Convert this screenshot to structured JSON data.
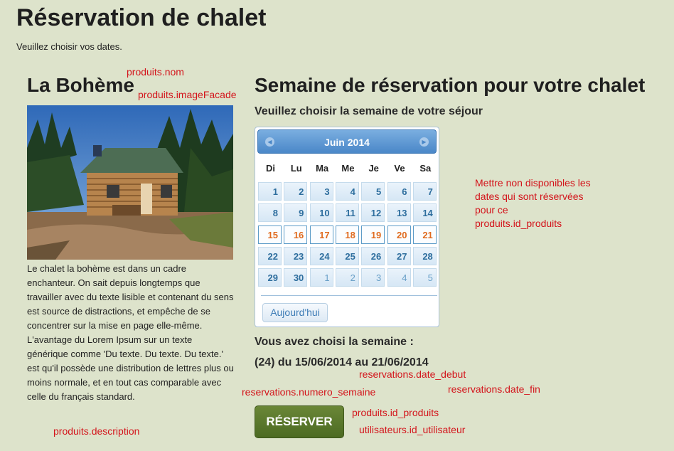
{
  "page": {
    "title": "Réservation de chalet",
    "subtitle": "Veuillez choisir vos dates."
  },
  "chalet": {
    "name": "La Bohème",
    "description": "Le chalet la bohème est dans un cadre enchanteur. On sait depuis longtemps que travailler avec du texte lisible et contenant du sens est source de distractions, et empêche de se concentrer sur la mise en page elle-même. L'avantage du Lorem Ipsum sur un texte générique comme 'Du texte. Du texte. Du texte.' est qu'il possède une distribution de lettres plus ou moins normale, et en tout cas comparable avec celle du français standard."
  },
  "booking": {
    "title": "Semaine de réservation pour votre chalet",
    "subtitle": "Veuillez choisir la semaine de votre séjour",
    "chosen_label": "Vous avez choisi la semaine :",
    "chosen_value": "(24) du 15/06/2014 au 21/06/2014",
    "reserve_label": "RÉSERVER"
  },
  "datepicker": {
    "month": "Juin 2014",
    "weekdays": [
      "Di",
      "Lu",
      "Ma",
      "Me",
      "Je",
      "Ve",
      "Sa"
    ],
    "weeks": [
      [
        "1",
        "2",
        "3",
        "4",
        "5",
        "6",
        "7"
      ],
      [
        "8",
        "9",
        "10",
        "11",
        "12",
        "13",
        "14"
      ],
      [
        "15",
        "16",
        "17",
        "18",
        "19",
        "20",
        "21"
      ],
      [
        "22",
        "23",
        "24",
        "25",
        "26",
        "27",
        "28"
      ],
      [
        "29",
        "30",
        "1",
        "2",
        "3",
        "4",
        "5"
      ]
    ],
    "selected_week_index": 2,
    "next_month_start": {
      "week": 4,
      "day": 2
    },
    "today_label": "Aujourd'hui"
  },
  "annotations": {
    "produits_nom": "produits.nom",
    "produits_image": "produits.imageFacade",
    "produits_description": "produits.description",
    "availability_note": [
      "Mettre non disponibles les",
      "dates qui sont réservées",
      "pour ce",
      "produits.id_produits"
    ],
    "date_debut": "reservations.date_debut",
    "numero_semaine": "reservations.numero_semaine",
    "date_fin": "reservations.date_fin",
    "id_produits": "produits.id_produits",
    "id_utilisateur": "utilisateurs.id_utilisateur"
  },
  "colors": {
    "background": "#dde3cb",
    "annotation": "#d3141b",
    "button": "#5a7a2c",
    "calendar_header": "#4a87c8"
  }
}
